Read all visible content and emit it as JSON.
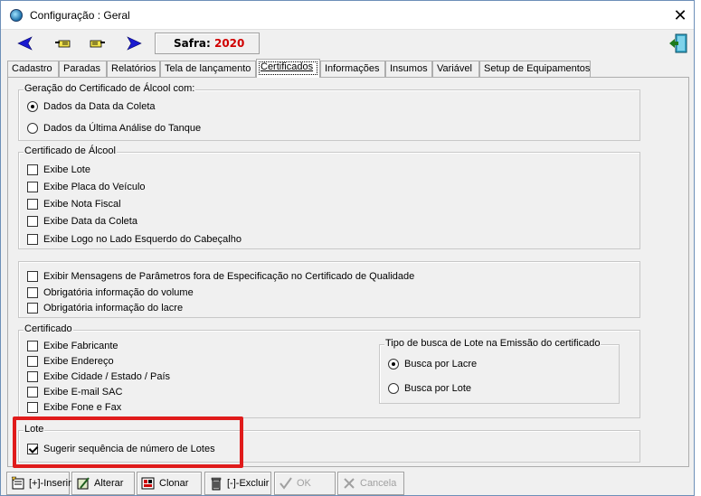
{
  "window": {
    "title": "Configuração : Geral",
    "close_glyph": "✕"
  },
  "toolbar": {
    "safra_label": "Safra:",
    "safra_value": "2020"
  },
  "tabs": [
    {
      "label": "Cadastro"
    },
    {
      "label": "Paradas"
    },
    {
      "label": "Relatórios"
    },
    {
      "label": "Tela de lançamento"
    },
    {
      "label": "Certificados",
      "active": true
    },
    {
      "label": "Informações"
    },
    {
      "label": "Insumos"
    },
    {
      "label": "Variável"
    },
    {
      "label": "Setup de Equipamentos"
    }
  ],
  "geracao": {
    "legend": "Geração do Certificado de Álcool com:",
    "options": [
      {
        "label": "Dados da Data da Coleta",
        "checked": true
      },
      {
        "label": "Dados da Última Análise do Tanque",
        "checked": false
      }
    ]
  },
  "cert_alcool": {
    "legend": "Certificado de Álcool",
    "items": [
      {
        "label": "Exibe Lote",
        "checked": false
      },
      {
        "label": "Exibe Placa do Veículo",
        "checked": false
      },
      {
        "label": "Exibe Nota Fiscal",
        "checked": false
      },
      {
        "label": "Exibe Data da Coleta",
        "checked": false
      },
      {
        "label": "Exibe Logo no Lado Esquerdo do Cabeçalho",
        "checked": false
      }
    ]
  },
  "misc": {
    "items": [
      {
        "label": "Exibir Mensagens de Parâmetros fora de Especificação no Certificado de Qualidade",
        "checked": false
      },
      {
        "label": "Obrigatória informação do volume",
        "checked": false
      },
      {
        "label": "Obrigatória informação do lacre",
        "checked": false
      }
    ]
  },
  "certificado": {
    "legend": "Certificado",
    "items": [
      {
        "label": "Exibe Fabricante",
        "checked": false
      },
      {
        "label": "Exibe Endereço",
        "checked": false
      },
      {
        "label": "Exibe Cidade / Estado / País",
        "checked": false
      },
      {
        "label": "Exibe E-mail SAC",
        "checked": false
      },
      {
        "label": "Exibe Fone e Fax",
        "checked": false
      }
    ],
    "tipo_busca": {
      "legend": "Tipo de busca de Lote na Emissão do certificado",
      "options": [
        {
          "label": "Busca por Lacre",
          "checked": true
        },
        {
          "label": "Busca por Lote",
          "checked": false
        }
      ]
    }
  },
  "lote": {
    "legend": "Lote",
    "items": [
      {
        "label": "Sugerir sequência de número de Lotes",
        "checked": true
      }
    ]
  },
  "buttons": [
    {
      "label": "[+]-Inserir",
      "icon": "insert-icon",
      "enabled": true
    },
    {
      "label": "Alterar",
      "icon": "edit-icon",
      "enabled": true
    },
    {
      "label": "Clonar",
      "icon": "clone-icon",
      "enabled": true
    },
    {
      "label": "[-]-Excluir",
      "icon": "trash-icon",
      "enabled": true
    },
    {
      "label": "OK",
      "icon": "check-icon",
      "enabled": false
    },
    {
      "label": "Cancela",
      "icon": "cancel-icon",
      "enabled": false
    }
  ],
  "colors": {
    "highlight": "#e01b1b",
    "safra_value": "#d00000",
    "nav_arrow": "#1a1ad0"
  }
}
